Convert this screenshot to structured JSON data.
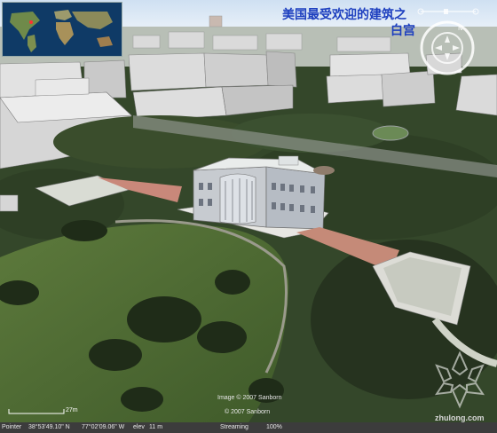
{
  "title": {
    "line1": "美国最受欢迎的建筑之",
    "line2": "白宫"
  },
  "credits": {
    "image": "Image © 2007 Sanborn",
    "copyright": "© 2007 Sanborn"
  },
  "scale": {
    "label": "27m"
  },
  "status": {
    "pointer_label": "Pointer",
    "latitude": "38°53'49.10\" N",
    "longitude": "77°02'09.06\" W",
    "elev_label": "elev",
    "elev_value": "11 m",
    "streaming_label": "Streaming",
    "streaming_percent": "100%"
  },
  "watermark": {
    "site": "zhulong.com"
  },
  "colors": {
    "title": "#1d3fbf",
    "statusbar": "#3c3c3c",
    "lawn": "#4f6a33",
    "trees": "#2b3a22"
  },
  "icons": {
    "compass": "navigation-compass-icon",
    "zoom": "zoom-slider-icon",
    "watermark": "zhulong-logo-icon"
  }
}
